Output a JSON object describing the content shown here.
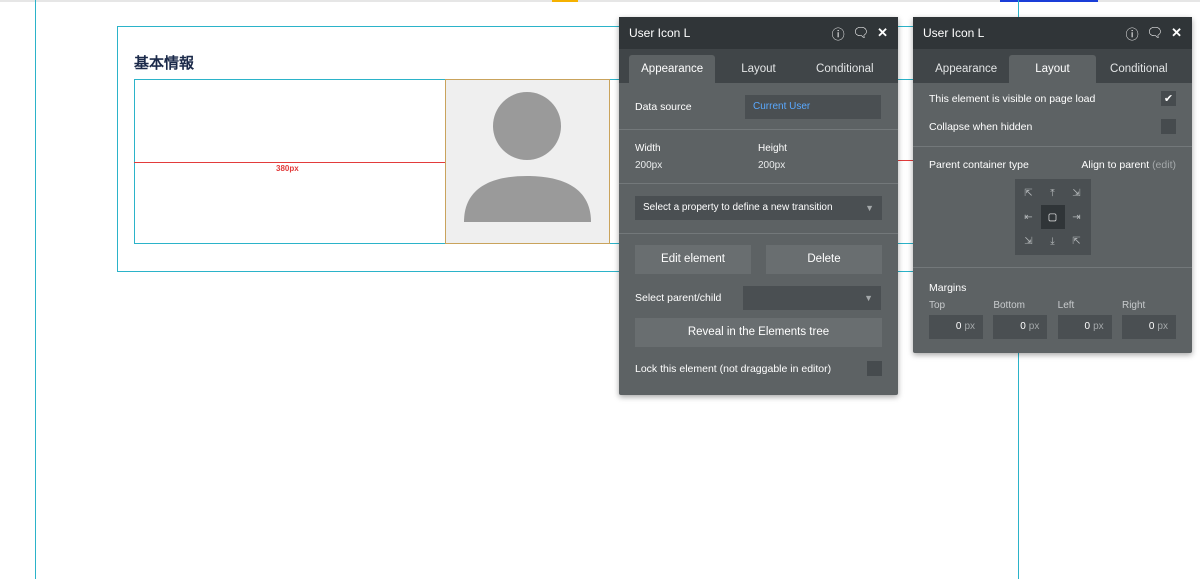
{
  "canvas": {
    "section_title": "基本情報",
    "width_indicator": "380px",
    "avatar_fill": "#9a9a9a"
  },
  "panel_left": {
    "title": "User Icon L",
    "tabs": [
      "Appearance",
      "Layout",
      "Conditional"
    ],
    "active_tab": "Appearance",
    "data_source_label": "Data source",
    "data_source_value": "Current User",
    "width_label": "Width",
    "width_value": "200px",
    "height_label": "Height",
    "height_value": "200px",
    "transition_select": "Select a property to define a new transition",
    "edit_button": "Edit element",
    "delete_button": "Delete",
    "parent_child_label": "Select parent/child",
    "parent_child_value": "",
    "reveal_button": "Reveal in the Elements tree",
    "lock_label": "Lock this element (not draggable in editor)",
    "lock_checked": false
  },
  "panel_right": {
    "title": "User Icon L",
    "tabs": [
      "Appearance",
      "Layout",
      "Conditional"
    ],
    "active_tab": "Layout",
    "visible_label": "This element is visible on page load",
    "visible_checked": true,
    "collapse_label": "Collapse when hidden",
    "collapse_checked": false,
    "parent_type_label": "Parent container type",
    "align_label": "Align to parent",
    "align_edit": "(edit)",
    "align_selected": "center",
    "margins_label": "Margins",
    "margins": [
      {
        "label": "Top",
        "value": "0",
        "unit": "px"
      },
      {
        "label": "Bottom",
        "value": "0",
        "unit": "px"
      },
      {
        "label": "Left",
        "value": "0",
        "unit": "px"
      },
      {
        "label": "Right",
        "value": "0",
        "unit": "px"
      }
    ]
  },
  "colors": {
    "panel_bg": "#5d6264",
    "panel_header": "#303538",
    "guide_line": "#2bb3c9",
    "size_indicator": "#e23b3b",
    "link_blue": "#5aa9ff"
  }
}
